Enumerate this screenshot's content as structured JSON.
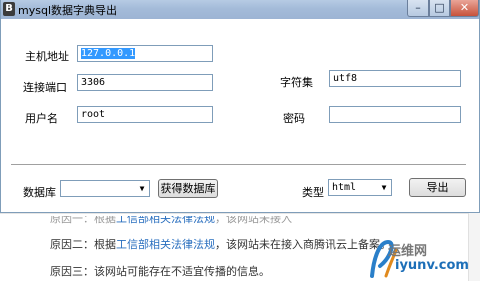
{
  "window": {
    "title": "mysql数据字典导出",
    "icon_letter": "B",
    "min_glyph": "–",
    "max_glyph": "□",
    "close_glyph": "✕"
  },
  "form": {
    "host_label": "主机地址",
    "host_value": "127.0.0.1",
    "port_label": "连接端口",
    "port_value": "3306",
    "charset_label": "字符集",
    "charset_value": "utf8",
    "user_label": "用户名",
    "user_value": "root",
    "password_label": "密码",
    "password_value": ""
  },
  "bottom": {
    "database_label": "数据库",
    "database_value": "",
    "get_db_button": "获得数据库",
    "type_label": "类型",
    "type_value": "html",
    "export_button": "导出",
    "dropdown_arrow": "▼"
  },
  "background_page": {
    "line1_prefix": "原因一：根据",
    "line1_link": "工信部相关法律法规",
    "line1_suffix": "，该网站未接入",
    "line2_prefix": "原因二：根据",
    "line2_link": "工信部相关法律法规",
    "line2_suffix": "，该网站未在接入商腾讯云上备案。",
    "line3": "原因三：该网站可能存在不适宜传播的信息。"
  },
  "watermark": {
    "text1": "运维网",
    "text2": "iyunv.com",
    "color": "#1d6fb8"
  }
}
